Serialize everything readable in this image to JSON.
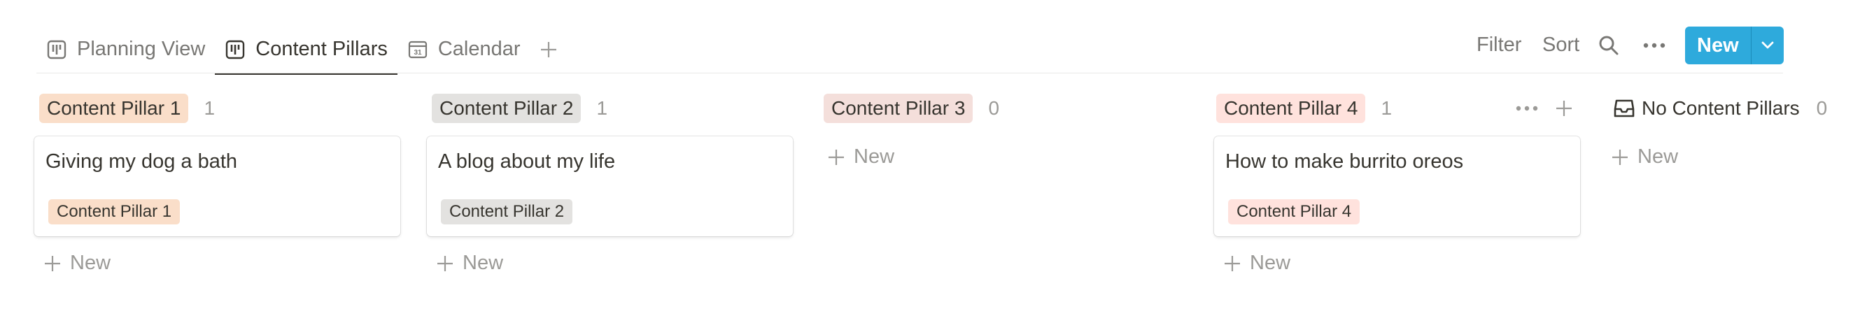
{
  "tabs": [
    {
      "label": "Planning View",
      "icon": "board-icon",
      "active": false
    },
    {
      "label": "Content Pillars",
      "icon": "board-icon",
      "active": true
    },
    {
      "label": "Calendar",
      "icon": "calendar-icon",
      "icon_text": "31",
      "active": false
    }
  ],
  "toolbar": {
    "filter_label": "Filter",
    "sort_label": "Sort",
    "new_label": "New"
  },
  "colors": {
    "accent": "#2eaadc",
    "pill1_bg": "#fadec9",
    "pill2_bg": "#e3e2e0",
    "pill3_bg": "#f4dfdb",
    "pill4_bg": "#ffe2dd"
  },
  "columns": [
    {
      "name": "Content Pillar 1",
      "count": "1",
      "cards": [
        {
          "title": "Giving my dog a bath",
          "tag": "Content Pillar 1"
        }
      ],
      "new_label": "New"
    },
    {
      "name": "Content Pillar 2",
      "count": "1",
      "cards": [
        {
          "title": "A blog about my life",
          "tag": "Content Pillar 2"
        }
      ],
      "new_label": "New"
    },
    {
      "name": "Content Pillar 3",
      "count": "0",
      "cards": [],
      "new_label": "New"
    },
    {
      "name": "Content Pillar 4",
      "count": "1",
      "cards": [
        {
          "title": "How to make burrito oreos",
          "tag": "Content Pillar 4"
        }
      ],
      "new_label": "New"
    },
    {
      "name": "No Content Pillars",
      "count": "0",
      "cards": [],
      "new_label": "New"
    }
  ]
}
